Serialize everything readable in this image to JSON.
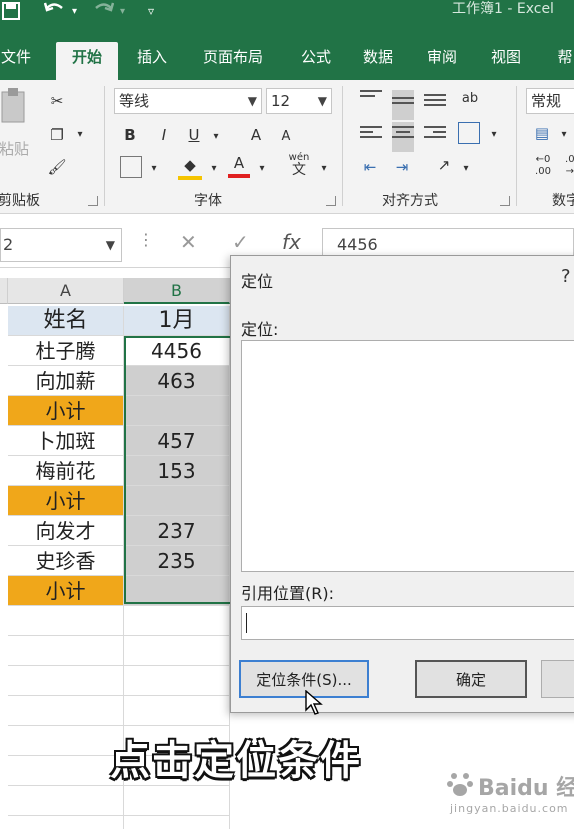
{
  "titlebar": {
    "title": "工作簿1 - Excel",
    "save_icon": "save-icon",
    "undo_icon": "undo-icon",
    "redo_icon": "redo-icon",
    "qat_icon": "customize-qat-icon"
  },
  "tabs": [
    "文件",
    "开始",
    "插入",
    "页面布局",
    "公式",
    "数据",
    "审阅",
    "视图",
    "帮"
  ],
  "ribbon": {
    "clipboard": {
      "paste": "粘贴",
      "label": "剪贴板"
    },
    "font": {
      "font_name": "等线",
      "font_size": "12",
      "bold": "B",
      "italic": "I",
      "underline": "U",
      "grow": "A",
      "shrink": "A",
      "font_color": "A",
      "phonetic": "wén",
      "phonetic_char": "文",
      "label": "字体"
    },
    "alignment": {
      "label": "对齐方式",
      "wrap": "ab"
    },
    "number": {
      "format": "常规",
      "label": "数字"
    }
  },
  "formula_bar": {
    "name_box": "2",
    "cancel": "✕",
    "enter": "✓",
    "fx": "fx",
    "value": "4456"
  },
  "sheet": {
    "columns": [
      "A",
      "B"
    ],
    "header": {
      "a": "姓名",
      "b": "1月"
    },
    "rows": [
      {
        "a": "杜子腾",
        "b": "4456",
        "type": "data"
      },
      {
        "a": "向加薪",
        "b": "463",
        "type": "data"
      },
      {
        "a": "小计",
        "b": "",
        "type": "subtotal"
      },
      {
        "a": "卜加斑",
        "b": "457",
        "type": "data"
      },
      {
        "a": "梅前花",
        "b": "153",
        "type": "data"
      },
      {
        "a": "小计",
        "b": "",
        "type": "subtotal"
      },
      {
        "a": "向发才",
        "b": "237",
        "type": "data"
      },
      {
        "a": "史珍香",
        "b": "235",
        "type": "data"
      },
      {
        "a": "小计",
        "b": "",
        "type": "subtotal"
      }
    ],
    "colors": {
      "header_fill": "#dce6f1",
      "subtotal_fill": "#f0a71a",
      "selection": "#217346"
    }
  },
  "dialog": {
    "title": "定位",
    "help": "?",
    "goto_label": "定位:",
    "reference_label": "引用位置(R):",
    "special_button": "定位条件(S)...",
    "ok_button": "确定"
  },
  "subtitle": "点击定位条件",
  "watermark": {
    "main": "Baidu 经验",
    "sub": "jingyan.baidu.com"
  },
  "colors": {
    "accent": "#217346"
  }
}
